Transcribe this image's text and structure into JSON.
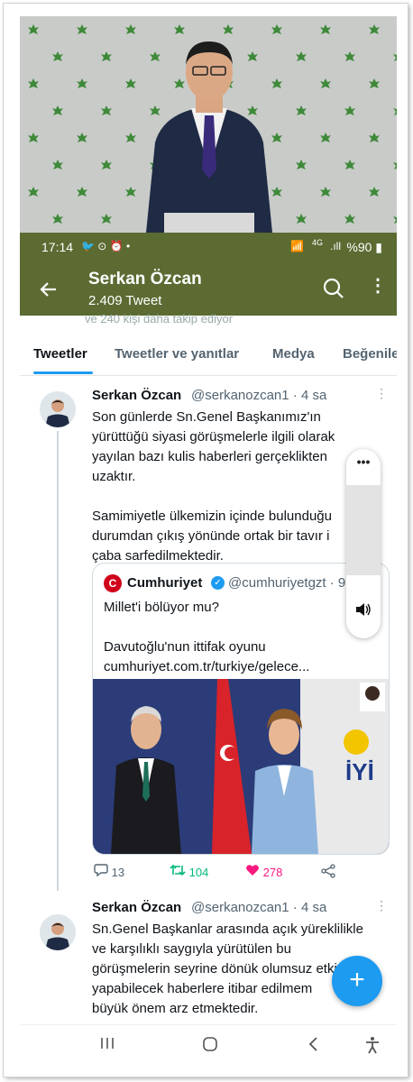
{
  "status": {
    "time": "17:14",
    "battery": "%90",
    "network": "4G"
  },
  "header": {
    "title": "Serkan Özcan",
    "subtitle": "2.409 Tweet"
  },
  "behind_text": "ve 240 kişi daha takip ediyor",
  "tabs": [
    "Tweetler",
    "Tweetler ve yanıtlar",
    "Medya",
    "Beğenile"
  ],
  "tweet1": {
    "name": "Serkan Özcan",
    "handle": "@serkanozcan1 · 4 sa",
    "text": "Son günlerde Sn.Genel Başkanımız'ın\nyürüttüğü siyasi görüşmelerle ilgili olarak\nyayılan bazı kulis haberleri gerçeklikten\nuzaktır.\n\nSamimiyetle ülkemizin içinde bulunduğu\ndurumdan çıkış yönünde ortak bir tavır i\nçaba sarfedilmektedir.",
    "quote": {
      "logo": "C",
      "name": "Cumhuriyet",
      "handle": "@cumhuriyetgzt · 9",
      "text": "Millet'i bölüyor mu?\n\nDavutoğlu'nun ittifak oyunu\ncumhuriyet.com.tr/turkiye/gelece..."
    },
    "replies": "13",
    "retweets": "104",
    "likes": "278"
  },
  "tweet2": {
    "name": "Serkan Özcan",
    "handle": "@serkanozcan1 · 4 sa",
    "text": "Sn.Genel Başkanlar arasında açık yüreklilikle\nve karşılıklı saygıyla yürütülen bu\ngörüşmelerin seyrine dönük olumsuz etki\nyapabilecek haberlere itibar edilmem\nbüyük önem arz etmektedir."
  },
  "colors": {
    "header_bg": "#5b6b32",
    "accent": "#1d9bf0",
    "retweet": "#00ba7c",
    "like": "#f91880"
  },
  "icons": [
    "back-arrow-icon",
    "search-icon",
    "more-vertical-icon",
    "reply-icon",
    "retweet-icon",
    "heart-icon",
    "share-icon",
    "volume-icon",
    "plus-icon"
  ]
}
